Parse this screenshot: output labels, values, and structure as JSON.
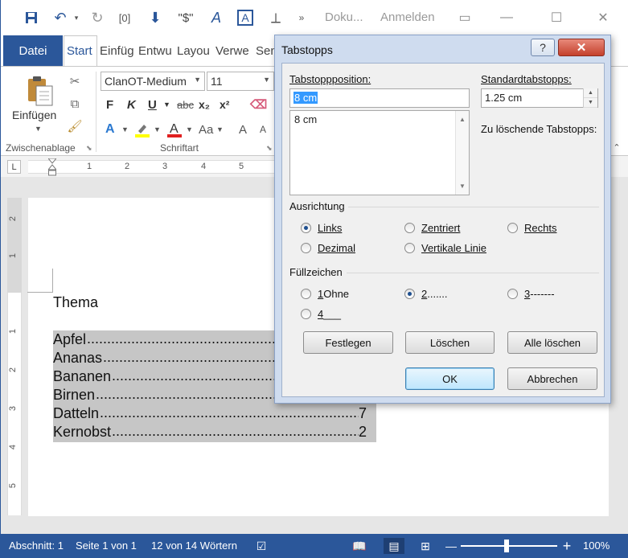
{
  "titlebar": {
    "title": "Doku...",
    "signin": "Anmelden",
    "qat": {
      "format_label": "\"$\""
    }
  },
  "ribbon": {
    "tabs": [
      "Datei",
      "Start",
      "Einfüg",
      "Entwu",
      "Layou",
      "Verwe",
      "Sen"
    ],
    "active_tab": "Start",
    "clipboard": {
      "paste_label": "Einfügen",
      "group_label": "Zwischenablage"
    },
    "font": {
      "name": "ClanOT-Medium",
      "size": "11",
      "group_label": "Schriftart",
      "bold": "F",
      "italic": "K",
      "underline": "U",
      "strike": "abc",
      "sub": "x₂",
      "sup": "x²",
      "case": "Aa",
      "grow": "A",
      "shrink": "A"
    }
  },
  "ruler": {
    "numbers": [
      "1",
      "2",
      "3",
      "4",
      "5"
    ],
    "vertical": [
      "2",
      "1",
      "1",
      "2",
      "3",
      "4",
      "5"
    ],
    "tab_selector": "L"
  },
  "document": {
    "heading": "Thema",
    "entries": [
      {
        "label": "Apfel",
        "page": ""
      },
      {
        "label": "Ananas",
        "page": ""
      },
      {
        "label": "Bananen",
        "page": ""
      },
      {
        "label": "Birnen",
        "page": ""
      },
      {
        "label": "Datteln",
        "page": "7"
      },
      {
        "label": "Kernobst",
        "page": "2"
      }
    ]
  },
  "statusbar": {
    "section": "Abschnitt: 1",
    "page": "Seite 1 von 1",
    "words": "12 von 14 Wörtern",
    "zoom": "100%"
  },
  "dialog": {
    "title": "Tabstopps",
    "position_label": "Tabstoppposition:",
    "position_value": "8 cm",
    "list_items": [
      "8 cm"
    ],
    "default_label": "Standardtabstopps:",
    "default_value": "1.25 cm",
    "clear_label": "Zu löschende Tabstopps:",
    "alignment_label": "Ausrichtung",
    "alignment_options": [
      {
        "label": "Links",
        "checked": true
      },
      {
        "label": "Zentriert",
        "checked": false
      },
      {
        "label": "Rechts",
        "checked": false
      },
      {
        "label": "Dezimal",
        "checked": false
      },
      {
        "label": "Vertikale Linie",
        "checked": false
      }
    ],
    "leader_label": "Füllzeichen",
    "leader_options": [
      {
        "num": "1",
        "label": " Ohne",
        "checked": false
      },
      {
        "num": "2",
        "label": " .......",
        "checked": true
      },
      {
        "num": "3",
        "label": " -------",
        "checked": false
      },
      {
        "num": "4",
        "label": " ___",
        "checked": false
      }
    ],
    "buttons": {
      "set": "Festlegen",
      "clear": "Löschen",
      "clear_all": "Alle löschen",
      "ok": "OK",
      "cancel": "Abbrechen"
    }
  }
}
